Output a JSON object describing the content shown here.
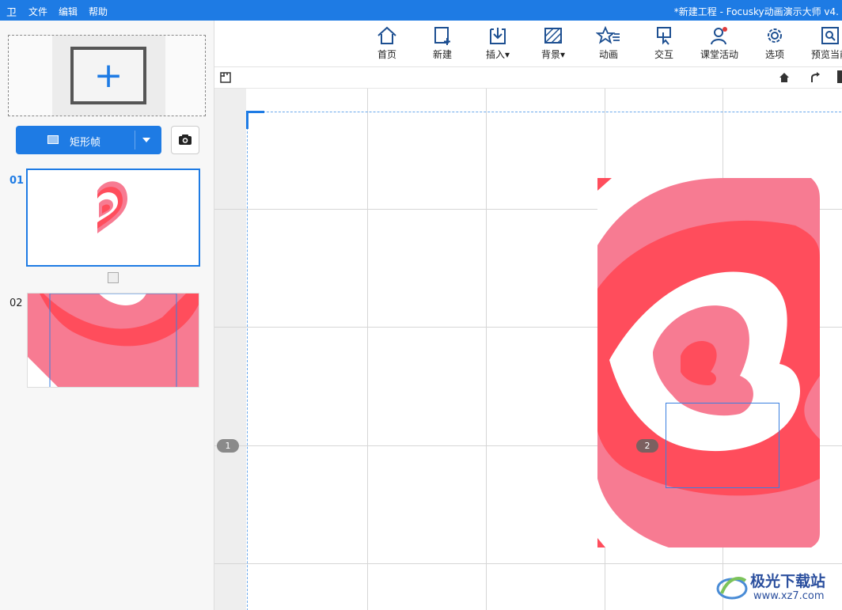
{
  "titlebar": {
    "logo": "卫",
    "menu": [
      "文件",
      "编辑",
      "帮助"
    ],
    "title": "*新建工程 - Focusky动画演示大师  v4."
  },
  "leftpanel": {
    "add_frame_symbol": "+",
    "frame_button_label": "矩形帧",
    "slides": [
      {
        "number": "01"
      },
      {
        "number": "02"
      }
    ]
  },
  "toolbar": {
    "items": [
      {
        "label": "首页",
        "icon": "home-icon"
      },
      {
        "label": "新建",
        "icon": "new-slide-icon"
      },
      {
        "label": "插入",
        "icon": "insert-icon"
      },
      {
        "label": "背景",
        "icon": "background-icon"
      },
      {
        "label": "动画",
        "icon": "animation-icon"
      },
      {
        "label": "交互",
        "icon": "interaction-icon"
      },
      {
        "label": "课堂活动",
        "icon": "classroom-activity-icon"
      },
      {
        "label": "选项",
        "icon": "options-icon"
      },
      {
        "label": "预览当前",
        "icon": "preview-icon"
      }
    ]
  },
  "canvas": {
    "frame_markers": [
      "1",
      "2"
    ]
  },
  "watermark": {
    "name": "极光下载站",
    "url": "www.xz7.com"
  },
  "colors": {
    "accent": "#1e7be4",
    "heart_outer": "#f77b92",
    "heart_band": "#ff4d5c"
  }
}
